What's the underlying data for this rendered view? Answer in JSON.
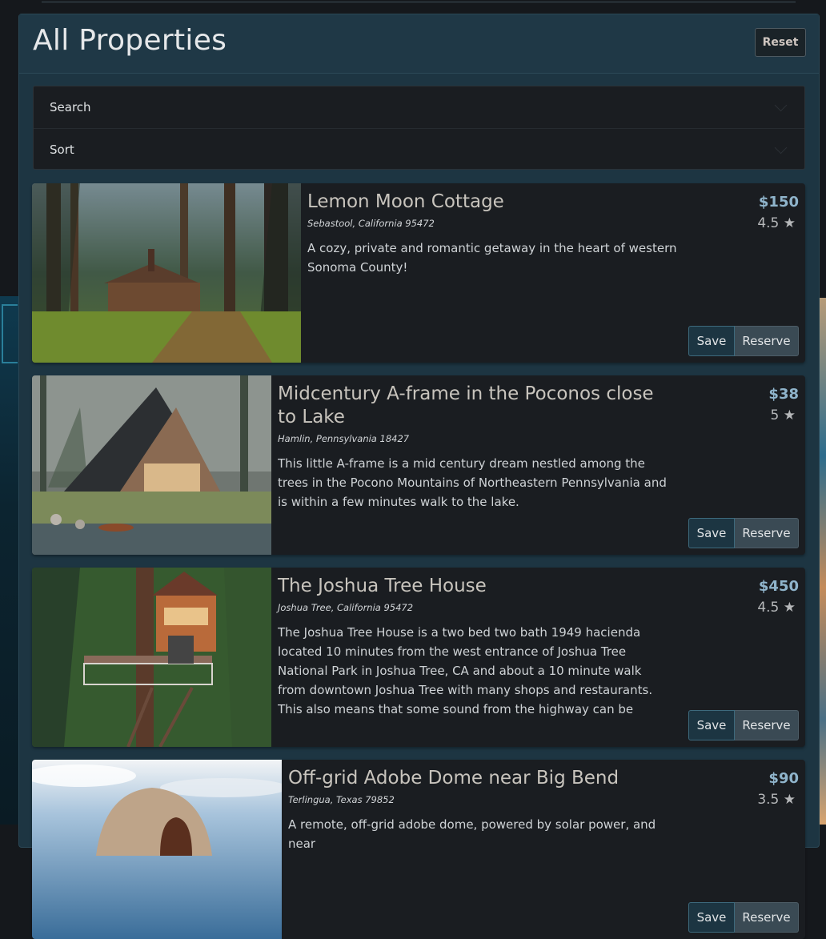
{
  "page": {
    "title": "All Properties",
    "reset_label": "Reset"
  },
  "filters": {
    "search_label": "Search",
    "sort_label": "Sort"
  },
  "listings": [
    {
      "title": "Lemon Moon Cottage",
      "location": "Sebastool, California 95472",
      "description": "A cozy, private and romantic getaway in the heart of western Sonoma County!",
      "price": "$150",
      "rating": "4.5 ★",
      "save_label": "Save",
      "reserve_label": "Reserve"
    },
    {
      "title": "Midcentury A-frame in the Poconos close to Lake",
      "location": "Hamlin, Pennsylvania 18427",
      "description": "This little A-frame is a mid century dream nestled among the trees in the Pocono Mountains of Northeastern Pennsylvania and is within a few minutes walk to the lake.",
      "price": "$38",
      "rating": "5 ★",
      "save_label": "Save",
      "reserve_label": "Reserve"
    },
    {
      "title": "The Joshua Tree House",
      "location": "Joshua Tree, California 95472",
      "description": "The Joshua Tree House is a two bed two bath 1949 hacienda located 10 minutes from the west entrance of Joshua Tree National Park in Joshua Tree, CA and about a 10 minute walk from downtown Joshua Tree with many shops and restaurants. This also means that some sound from the highway can be heard. If youre looking for a",
      "price": "$450",
      "rating": "4.5 ★",
      "save_label": "Save",
      "reserve_label": "Reserve"
    },
    {
      "title": "Off-grid Adobe Dome near Big Bend",
      "location": "Terlingua, Texas 79852",
      "description": "A remote, off-grid adobe dome, powered by solar power, and near",
      "price": "$90",
      "rating": "3.5 ★",
      "save_label": "Save",
      "reserve_label": "Reserve"
    }
  ]
}
